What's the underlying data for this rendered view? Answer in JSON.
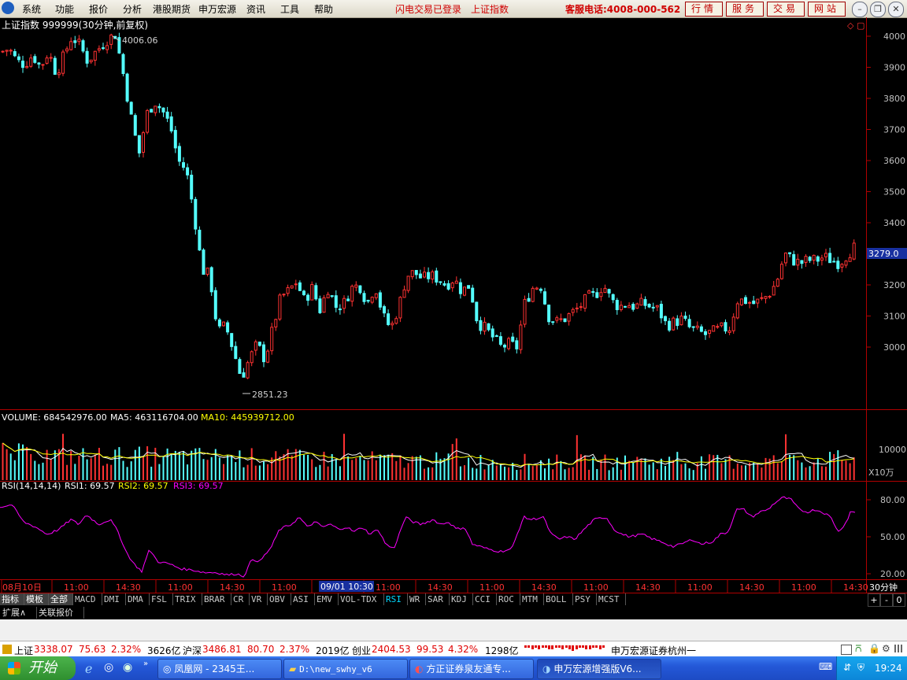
{
  "menubar": {
    "items": [
      "系统",
      "功能",
      "报价",
      "分析",
      "港股期货",
      "申万宏源",
      "资讯",
      "工具",
      "帮助"
    ],
    "status1": "闪电交易已登录",
    "status2": "上证指数",
    "hotline": "客服电话:4008-000-562",
    "right_buttons": [
      "行情",
      "服务",
      "交易",
      "网站"
    ]
  },
  "chart": {
    "title": "上证指数 999999(30分钟,前复权)",
    "high_label": "4006.06",
    "low_label": "2851.23",
    "price_axis": [
      "4000",
      "3900",
      "3800",
      "3700",
      "3600",
      "3500",
      "3400",
      "3300",
      "3200",
      "3100",
      "3000"
    ],
    "current_price": "3279.0",
    "volume_label": "VOLUME: 684542976.00",
    "ma5_label": "MA5: 463116704.00",
    "ma10_label": "MA10: 445939712.00",
    "volume_axis": "10000",
    "volume_unit": "X10万",
    "rsi_label": "RSI(14,14,14)",
    "rsi1_label": "RSI1: 69.57",
    "rsi2_label": "RSI2: 69.57",
    "rsi3_label": "RSI3: 69.57",
    "rsi_axis": [
      "80.00",
      "50.00",
      "20.00"
    ],
    "time_labels": [
      "08月10日",
      "11:00",
      "14:30",
      "11:00",
      "14:30",
      "11:00",
      "14:30",
      "11:00",
      "14:30",
      "11:00",
      "14:30",
      "11:00",
      "14:30",
      "11:00",
      "14:30",
      "11:00",
      "14:30"
    ],
    "cursor_time": "09/01 10:30",
    "period": "30分钟",
    "colors": {
      "up": "#ff3232",
      "down": "#54ffff",
      "ma5": "#ffffff",
      "ma10": "#ffff00",
      "rsi": "#ff00ff",
      "grid": "#b00000"
    }
  },
  "chart_data": {
    "type": "candlestick",
    "title": "上证指数 999999(30分钟,前复权)",
    "ylim": [
      2851.23,
      4006.06
    ],
    "price_anchor_points": [
      [
        0,
        3950
      ],
      [
        10,
        3960
      ],
      [
        20,
        3920
      ],
      [
        30,
        3910
      ],
      [
        40,
        3940
      ],
      [
        50,
        3900
      ],
      [
        60,
        3950
      ],
      [
        70,
        3880
      ],
      [
        80,
        3940
      ],
      [
        90,
        4000
      ],
      [
        100,
        3970
      ],
      [
        110,
        3920
      ],
      [
        120,
        3950
      ],
      [
        135,
        3990
      ],
      [
        145,
        4006.06
      ],
      [
        155,
        3880
      ],
      [
        165,
        3740
      ],
      [
        175,
        3620
      ],
      [
        185,
        3750
      ],
      [
        195,
        3790
      ],
      [
        205,
        3760
      ],
      [
        215,
        3710
      ],
      [
        225,
        3600
      ],
      [
        235,
        3570
      ],
      [
        245,
        3430
      ],
      [
        255,
        3250
      ],
      [
        265,
        3230
      ],
      [
        275,
        3050
      ],
      [
        285,
        3070
      ],
      [
        295,
        2990
      ],
      [
        305,
        2900
      ],
      [
        315,
        2960
      ],
      [
        325,
        3010
      ],
      [
        335,
        2960
      ],
      [
        345,
        3060
      ],
      [
        355,
        3160
      ],
      [
        365,
        3180
      ],
      [
        375,
        3210
      ],
      [
        385,
        3150
      ],
      [
        395,
        3190
      ],
      [
        405,
        3120
      ],
      [
        415,
        3190
      ],
      [
        425,
        3130
      ],
      [
        435,
        3140
      ],
      [
        445,
        3190
      ],
      [
        455,
        3200
      ],
      [
        465,
        3140
      ],
      [
        475,
        3200
      ],
      [
        485,
        3100
      ],
      [
        495,
        3060
      ],
      [
        505,
        3130
      ],
      [
        515,
        3230
      ],
      [
        525,
        3240
      ],
      [
        535,
        3220
      ],
      [
        545,
        3230
      ],
      [
        555,
        3220
      ],
      [
        565,
        3200
      ],
      [
        575,
        3220
      ],
      [
        585,
        3180
      ],
      [
        595,
        3200
      ],
      [
        605,
        3080
      ],
      [
        615,
        3060
      ],
      [
        625,
        3030
      ],
      [
        635,
        3000
      ],
      [
        645,
        3010
      ],
      [
        655,
        3000
      ],
      [
        665,
        3140
      ],
      [
        675,
        3190
      ],
      [
        685,
        3200
      ],
      [
        695,
        3100
      ],
      [
        705,
        3080
      ],
      [
        715,
        3090
      ],
      [
        725,
        3110
      ],
      [
        735,
        3130
      ],
      [
        745,
        3160
      ],
      [
        755,
        3170
      ],
      [
        765,
        3200
      ],
      [
        775,
        3150
      ],
      [
        785,
        3130
      ],
      [
        795,
        3140
      ],
      [
        805,
        3130
      ],
      [
        815,
        3140
      ],
      [
        825,
        3130
      ],
      [
        835,
        3120
      ],
      [
        845,
        3070
      ],
      [
        855,
        3080
      ],
      [
        865,
        3090
      ],
      [
        875,
        3060
      ],
      [
        885,
        3050
      ],
      [
        895,
        3040
      ],
      [
        905,
        3050
      ],
      [
        915,
        3060
      ],
      [
        925,
        3060
      ],
      [
        935,
        3150
      ],
      [
        945,
        3150
      ],
      [
        955,
        3140
      ],
      [
        965,
        3150
      ],
      [
        975,
        3170
      ],
      [
        985,
        3210
      ],
      [
        995,
        3300
      ],
      [
        1005,
        3280
      ],
      [
        1015,
        3270
      ],
      [
        1025,
        3280
      ],
      [
        1035,
        3280
      ],
      [
        1045,
        3290
      ],
      [
        1055,
        3280
      ],
      [
        1065,
        3270
      ],
      [
        1075,
        3300
      ],
      [
        1088,
        3330
      ]
    ],
    "rsi_anchor_points": [
      [
        0,
        74
      ],
      [
        15,
        76
      ],
      [
        30,
        62
      ],
      [
        45,
        58
      ],
      [
        60,
        52
      ],
      [
        75,
        56
      ],
      [
        90,
        64
      ],
      [
        100,
        60
      ],
      [
        110,
        68
      ],
      [
        125,
        60
      ],
      [
        140,
        64
      ],
      [
        150,
        54
      ],
      [
        160,
        38
      ],
      [
        170,
        28
      ],
      [
        180,
        22
      ],
      [
        190,
        40
      ],
      [
        200,
        30
      ],
      [
        215,
        28
      ],
      [
        230,
        24
      ],
      [
        245,
        23
      ],
      [
        260,
        21
      ],
      [
        275,
        21
      ],
      [
        290,
        19
      ],
      [
        300,
        20
      ],
      [
        310,
        18
      ],
      [
        320,
        32
      ],
      [
        330,
        30
      ],
      [
        345,
        42
      ],
      [
        355,
        56
      ],
      [
        370,
        60
      ],
      [
        380,
        66
      ],
      [
        390,
        58
      ],
      [
        400,
        62
      ],
      [
        410,
        58
      ],
      [
        420,
        60
      ],
      [
        430,
        56
      ],
      [
        440,
        58
      ],
      [
        450,
        54
      ],
      [
        460,
        58
      ],
      [
        470,
        52
      ],
      [
        480,
        56
      ],
      [
        490,
        44
      ],
      [
        500,
        40
      ],
      [
        515,
        66
      ],
      [
        525,
        62
      ],
      [
        535,
        60
      ],
      [
        550,
        64
      ],
      [
        560,
        60
      ],
      [
        570,
        62
      ],
      [
        580,
        56
      ],
      [
        590,
        58
      ],
      [
        600,
        44
      ],
      [
        610,
        42
      ],
      [
        620,
        40
      ],
      [
        635,
        38
      ],
      [
        650,
        40
      ],
      [
        665,
        66
      ],
      [
        675,
        64
      ],
      [
        690,
        66
      ],
      [
        700,
        52
      ],
      [
        710,
        48
      ],
      [
        720,
        50
      ],
      [
        730,
        48
      ],
      [
        745,
        58
      ],
      [
        755,
        64
      ],
      [
        770,
        66
      ],
      [
        780,
        56
      ],
      [
        790,
        52
      ],
      [
        800,
        50
      ],
      [
        815,
        52
      ],
      [
        830,
        48
      ],
      [
        840,
        46
      ],
      [
        855,
        42
      ],
      [
        865,
        44
      ],
      [
        880,
        48
      ],
      [
        890,
        44
      ],
      [
        905,
        46
      ],
      [
        915,
        52
      ],
      [
        925,
        54
      ],
      [
        935,
        72
      ],
      [
        945,
        72
      ],
      [
        955,
        66
      ],
      [
        965,
        70
      ],
      [
        975,
        72
      ],
      [
        985,
        78
      ],
      [
        995,
        82
      ],
      [
        1005,
        80
      ],
      [
        1015,
        72
      ],
      [
        1025,
        70
      ],
      [
        1035,
        72
      ],
      [
        1045,
        70
      ],
      [
        1055,
        66
      ],
      [
        1065,
        54
      ],
      [
        1075,
        62
      ],
      [
        1080,
        70
      ],
      [
        1088,
        70
      ]
    ],
    "volume_anchor_points": [
      [
        0,
        0.55
      ],
      [
        100,
        0.5
      ],
      [
        200,
        0.5
      ],
      [
        300,
        0.48
      ],
      [
        400,
        0.45
      ],
      [
        500,
        0.42
      ],
      [
        600,
        0.4
      ],
      [
        700,
        0.38
      ],
      [
        800,
        0.38
      ],
      [
        900,
        0.38
      ],
      [
        1000,
        0.42
      ],
      [
        1088,
        0.45
      ]
    ]
  },
  "tabs": [
    "指标",
    "模板",
    "全部",
    "MACD",
    "DMI",
    "DMA",
    "FSL",
    "TRIX",
    "BRAR",
    "CR",
    "VR",
    "OBV",
    "ASI",
    "EMV",
    "VOL-TDX",
    "RSI",
    "WR",
    "SAR",
    "KDJ",
    "CCI",
    "ROC",
    "MTM",
    "BOLL",
    "PSY",
    "MCST"
  ],
  "tabs2": [
    "扩展∧",
    "关联报价"
  ],
  "rightnav": [
    "+",
    "-",
    "0"
  ],
  "ticker": {
    "sh_label": "上证",
    "sh_val": "3338.07",
    "sh_chg": "75.63",
    "sh_pct": "2.32%",
    "sh_amt": "3626亿",
    "hs_label": "沪深",
    "hs_val": "3486.81",
    "hs_chg": "80.70",
    "hs_pct": "2.37%",
    "hs_amt": "2019亿",
    "cy_label": "创业",
    "cy_val": "2404.53",
    "cy_chg": "99.53",
    "cy_pct": "4.32%",
    "cy_amt": "1298亿",
    "broker": "申万宏源证券杭州一"
  },
  "taskbar": {
    "start": "开始",
    "tasks": [
      "凤凰网 - 2345王...",
      "D:\\new_swhy_v6",
      "方正证券泉友通专...",
      "申万宏源增强版V6..."
    ],
    "clock": "19:24"
  }
}
